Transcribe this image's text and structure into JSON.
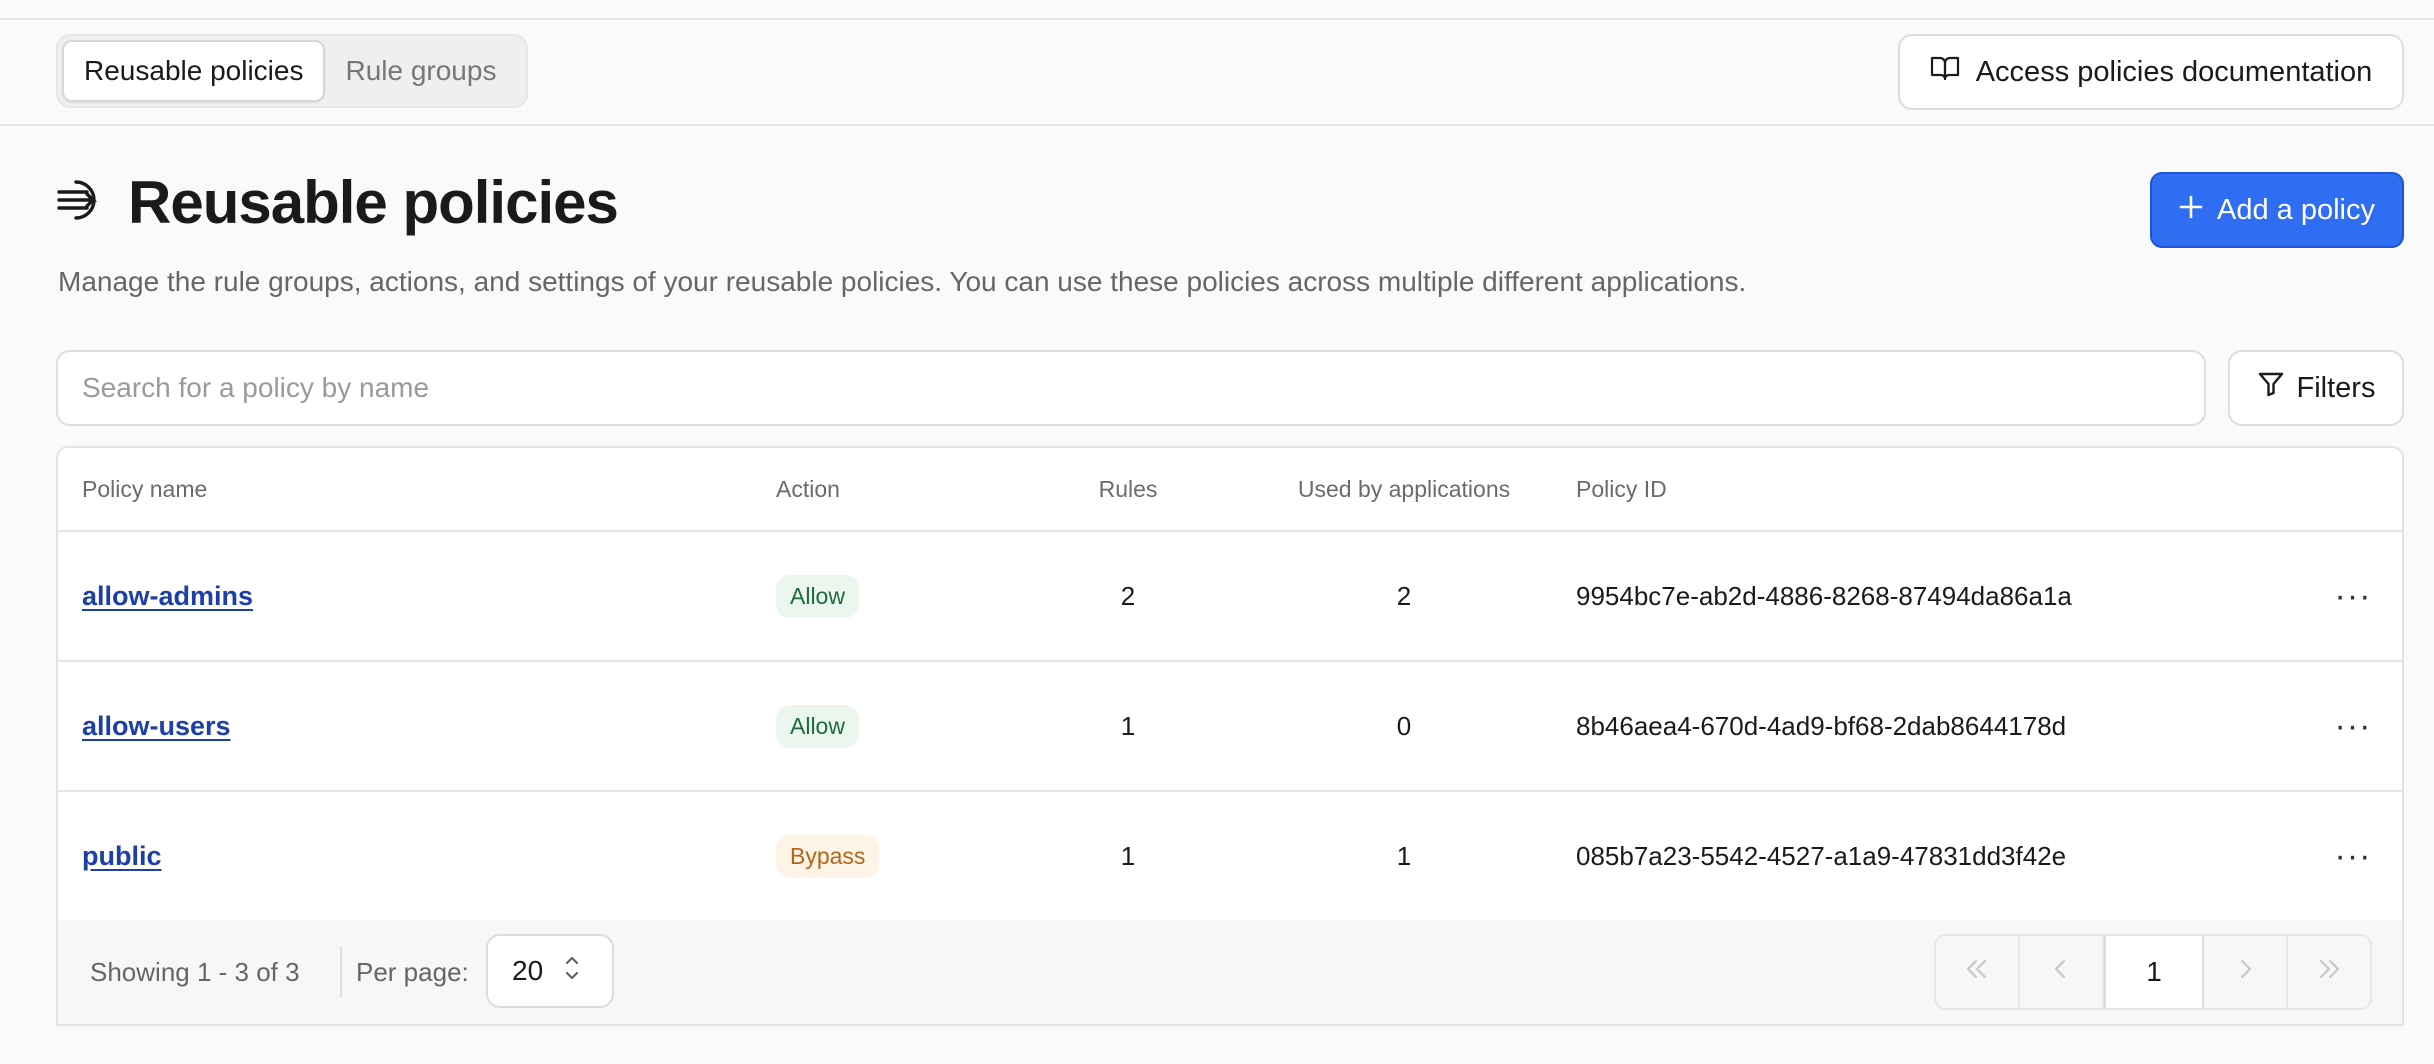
{
  "tabs": [
    {
      "label": "Reusable policies",
      "active": true
    },
    {
      "label": "Rule groups",
      "active": false
    }
  ],
  "header": {
    "doc_button_label": "Access policies documentation",
    "doc_icon": "book-open-icon"
  },
  "page": {
    "title": "Reusable policies",
    "title_icon": "policy-arrows-icon",
    "subtitle": "Manage the rule groups, actions, and settings of your reusable policies. You can use these policies across multiple different applications.",
    "add_button_label": "Add a policy",
    "accent_color": "#2f6ef2"
  },
  "search": {
    "placeholder": "Search for a policy by name",
    "value": ""
  },
  "filters": {
    "label": "Filters",
    "icon": "filter-icon"
  },
  "table": {
    "columns": [
      "Policy name",
      "Action",
      "Rules",
      "Used by applications",
      "Policy ID"
    ],
    "rows": [
      {
        "name": "allow-admins",
        "action": "Allow",
        "rules": "2",
        "used": "2",
        "id": "9954bc7e-ab2d-4886-8268-87494da86a1a"
      },
      {
        "name": "allow-users",
        "action": "Allow",
        "rules": "1",
        "used": "0",
        "id": "8b46aea4-670d-4ad9-bf68-2dab8644178d"
      },
      {
        "name": "public",
        "action": "Bypass",
        "rules": "1",
        "used": "1",
        "id": "085b7a23-5542-4527-a1a9-47831dd3f42e"
      }
    ]
  },
  "footer": {
    "showing": "Showing 1 - 3 of 3",
    "per_page_label": "Per page:",
    "per_page_value": "20",
    "current_page": "1"
  }
}
